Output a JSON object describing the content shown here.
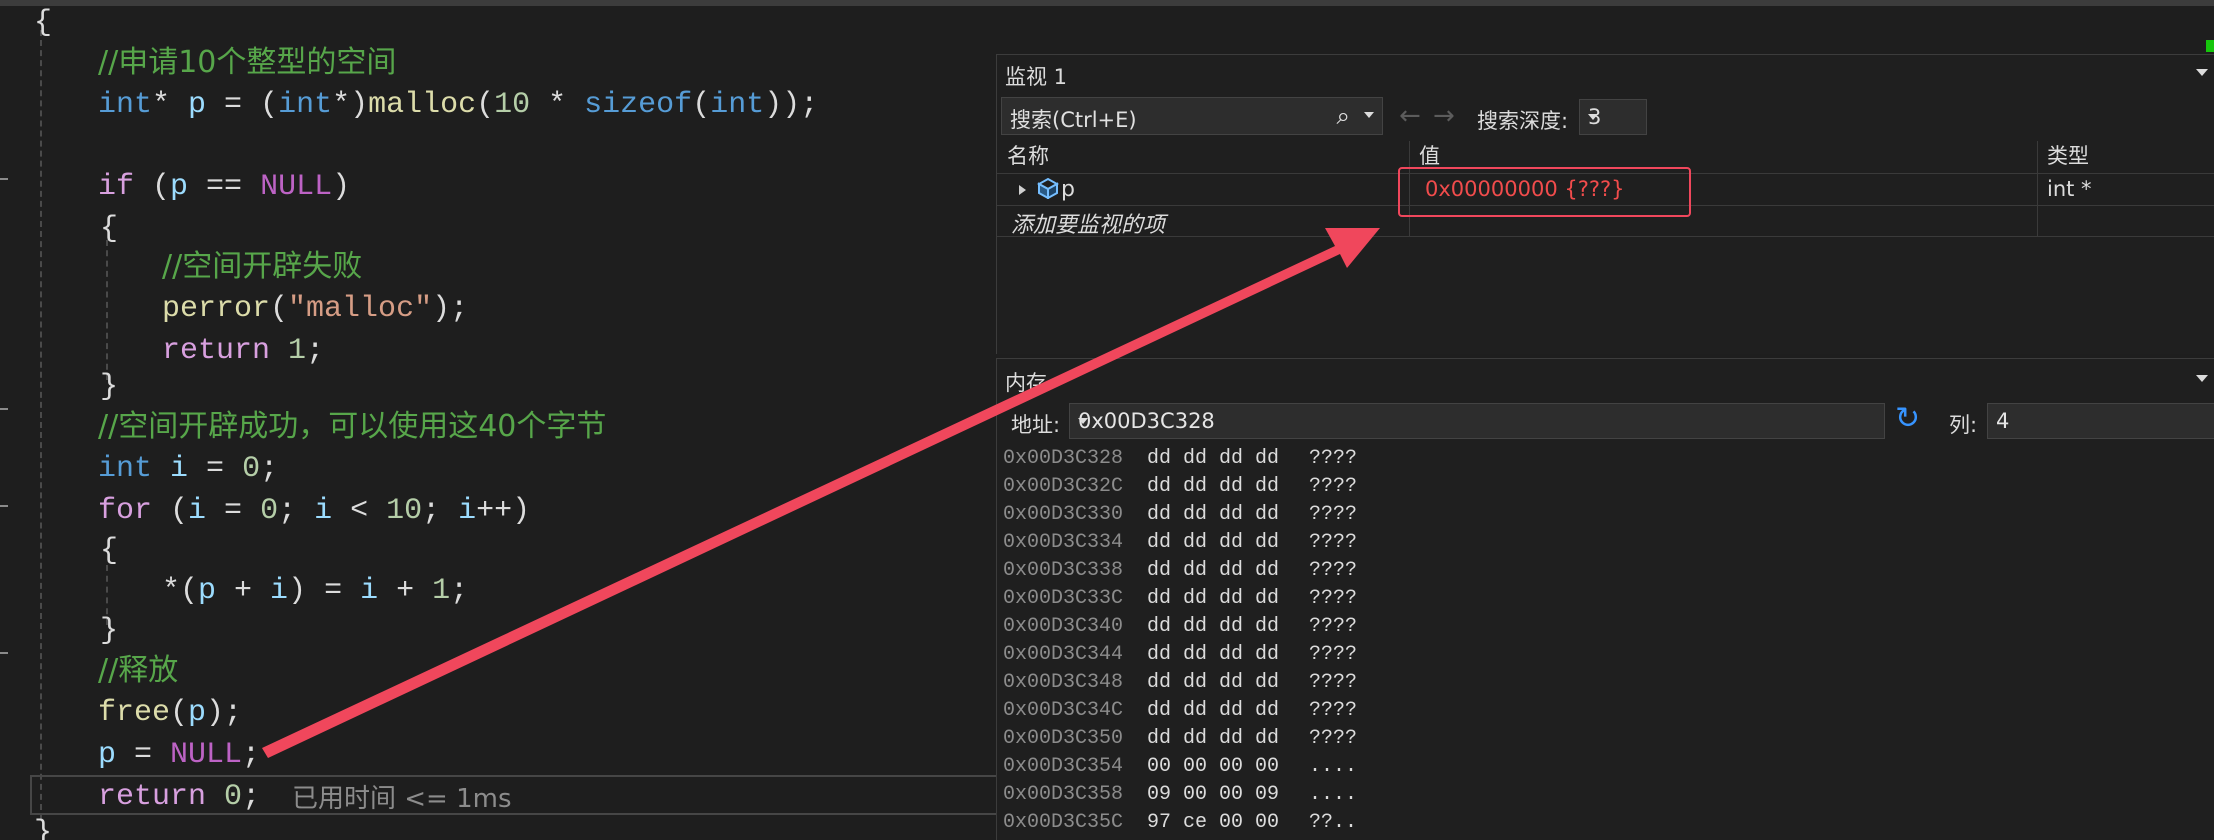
{
  "editor": {
    "open_brace": "{",
    "close_brace": "}",
    "lines": {
      "c1": "//申请10个整型的空间",
      "l2_a": "int",
      "l2_b": "* ",
      "l2_c": "p",
      "l2_d": " = (",
      "l2_e": "int",
      "l2_f": "*)",
      "l2_g": "malloc",
      "l2_h": "(",
      "l2_i": "10",
      "l2_j": " * ",
      "l2_k": "sizeof",
      "l2_l": "(",
      "l2_m": "int",
      "l2_n": "));",
      "l3_a": "if",
      "l3_b": " (",
      "l3_c": "p",
      "l3_d": " == ",
      "l3_e": "NULL",
      "l3_f": ")",
      "l4": "{",
      "c2": "//空间开辟失败",
      "l6_a": "perror",
      "l6_b": "(",
      "l6_c": "\"malloc\"",
      "l6_d": ");",
      "l7_a": "return",
      "l7_b": " ",
      "l7_c": "1",
      "l7_d": ";",
      "l8": "}",
      "c3": "//空间开辟成功，可以使用这40个字节",
      "l10_a": "int",
      "l10_b": " ",
      "l10_c": "i",
      "l10_d": " = ",
      "l10_e": "0",
      "l10_f": ";",
      "l11_a": "for",
      "l11_b": " (",
      "l11_c": "i",
      "l11_d": " = ",
      "l11_e": "0",
      "l11_f": "; ",
      "l11_g": "i",
      "l11_h": " < ",
      "l11_i": "10",
      "l11_j": "; ",
      "l11_k": "i",
      "l11_l": "++)",
      "l12": "{",
      "l13_a": "*(",
      "l13_b": "p",
      "l13_c": " + ",
      "l13_d": "i",
      "l13_e": ") = ",
      "l13_f": "i",
      "l13_g": " + ",
      "l13_h": "1",
      "l13_i": ";",
      "l14": "}",
      "c4": "//释放",
      "l16_a": "free",
      "l16_b": "(",
      "l16_c": "p",
      "l16_d": ");",
      "l17_a": "p",
      "l17_b": " = ",
      "l17_c": "NULL",
      "l17_d": ";",
      "l18_a": "return",
      "l18_b": " ",
      "l18_c": "0",
      "l18_d": ";"
    },
    "elapsed": "已用时间 <= 1ms"
  },
  "watch": {
    "title": "监视 1",
    "search_placeholder": "搜索(Ctrl+E)",
    "search_icon": "search-icon",
    "depth_label": "搜索深度:",
    "depth_value": "3",
    "columns": {
      "name": "名称",
      "value": "值",
      "type": "类型"
    },
    "row": {
      "name": "p",
      "value": "0x00000000 {???}",
      "type": "int *"
    },
    "add_item": "添加要监视的项",
    "value_color": "#f14c4c"
  },
  "memory": {
    "title": "内存",
    "address_label": "地址:",
    "address_value": "0x00D3C328",
    "columns_label": "列:",
    "columns_value": "4",
    "rows": [
      {
        "addr": "0x00D3C328",
        "bytes": "dd dd dd dd",
        "chars": "????"
      },
      {
        "addr": "0x00D3C32C",
        "bytes": "dd dd dd dd",
        "chars": "????"
      },
      {
        "addr": "0x00D3C330",
        "bytes": "dd dd dd dd",
        "chars": "????"
      },
      {
        "addr": "0x00D3C334",
        "bytes": "dd dd dd dd",
        "chars": "????"
      },
      {
        "addr": "0x00D3C338",
        "bytes": "dd dd dd dd",
        "chars": "????"
      },
      {
        "addr": "0x00D3C33C",
        "bytes": "dd dd dd dd",
        "chars": "????"
      },
      {
        "addr": "0x00D3C340",
        "bytes": "dd dd dd dd",
        "chars": "????"
      },
      {
        "addr": "0x00D3C344",
        "bytes": "dd dd dd dd",
        "chars": "????"
      },
      {
        "addr": "0x00D3C348",
        "bytes": "dd dd dd dd",
        "chars": "????"
      },
      {
        "addr": "0x00D3C34C",
        "bytes": "dd dd dd dd",
        "chars": "????"
      },
      {
        "addr": "0x00D3C350",
        "bytes": "dd dd dd dd",
        "chars": "????"
      },
      {
        "addr": "0x00D3C354",
        "bytes": "00 00 00 00",
        "chars": "...."
      },
      {
        "addr": "0x00D3C358",
        "bytes": "09 00 00 09",
        "chars": "...."
      },
      {
        "addr": "0x00D3C35C",
        "bytes": "97 ce 00 00",
        "chars": "??.."
      }
    ]
  },
  "annotation": {
    "arrow_color": "#f0475c"
  }
}
